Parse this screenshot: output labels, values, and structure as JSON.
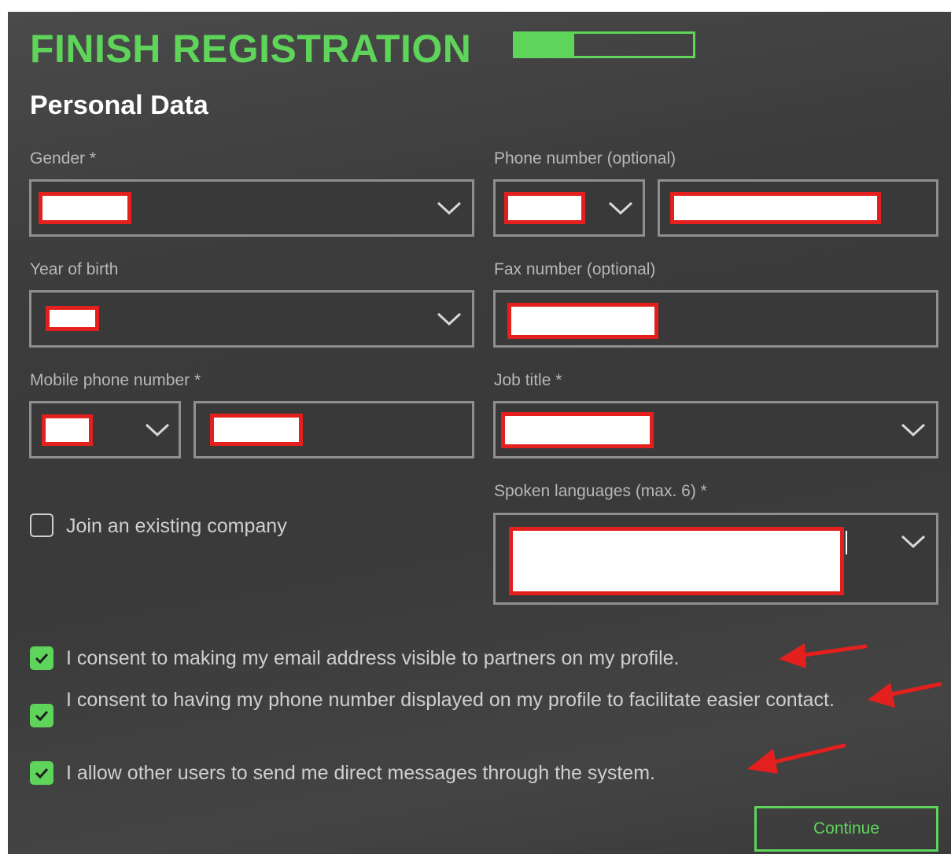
{
  "header": {
    "title": "FINISH REGISTRATION",
    "progress_fraction": 0.33,
    "accent_color": "#5fd45a"
  },
  "section": {
    "title": "Personal Data"
  },
  "fields": {
    "gender": {
      "label": "Gender *",
      "value": "[redacted]"
    },
    "phone": {
      "label": "Phone number (optional)",
      "code": "[redacted]",
      "value": "[redacted]"
    },
    "year_of_birth": {
      "label": "Year of birth",
      "value": "[redacted]"
    },
    "fax": {
      "label": "Fax number (optional)",
      "value": "[redacted]"
    },
    "mobile": {
      "label": "Mobile phone number *",
      "code": "[redacted]",
      "value": "[redacted]"
    },
    "job_title": {
      "label": "Job title *",
      "value": "[redacted]"
    },
    "spoken_languages": {
      "label": "Spoken languages (max. 6) *",
      "value": "[redacted]"
    }
  },
  "join_company": {
    "label": "Join an existing company",
    "checked": false
  },
  "consents": [
    {
      "text": "I consent to making my email address visible to partners on my profile.",
      "checked": true
    },
    {
      "text": "I consent to having my phone number displayed on my profile to facilitate easier contact.",
      "checked": true
    },
    {
      "text": "I allow other users to send me direct messages through the system.",
      "checked": true
    }
  ],
  "actions": {
    "continue_label": "Continue"
  },
  "icons": {
    "chevron": "chevron-down-icon",
    "check": "check-icon",
    "annotation_arrow": "red-arrow-annotation"
  },
  "redaction_color": "#e3201d"
}
